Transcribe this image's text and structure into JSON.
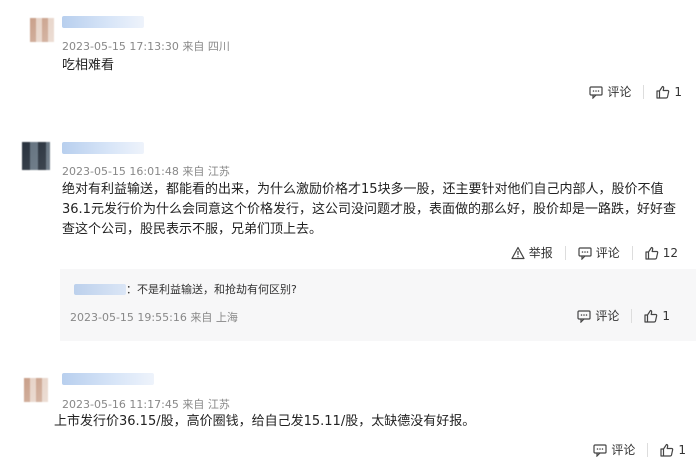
{
  "colors": {
    "background": "#ffffff",
    "meta_text": "#888888",
    "body_text": "#222222",
    "reply_background": "#f7f7f8",
    "username_blur": "#c9daf2"
  },
  "icons": {
    "comment": "speech-bubble-icon",
    "like": "thumbs-up-icon",
    "report": "warning-triangle-icon"
  },
  "comments": [
    {
      "username": "用户",
      "meta": "2023-05-15 17:13:30 来自 四川",
      "text": "吃相难看",
      "comment_label": "评论",
      "like_count": "1"
    },
    {
      "username": "用户",
      "meta": "2023-05-15 16:01:48 来自 江苏",
      "text": "绝对有利益输送，都能看的出来，为什么激励价格才15块多一股，还主要针对他们自己内部人，股价不值36.1元发行价为什么会同意这个价格发行，这公司没问题才股，表面做的那么好，股价却是一路跌，好好查查这个公司，股民表示不服，兄弟们顶上去。",
      "report_label": "举报",
      "comment_label": "评论",
      "like_count": "12",
      "reply": {
        "username": "用户",
        "text": "：不是利益输送，和抢劫有何区别?",
        "meta": "2023-05-15 19:55:16  来自 上海",
        "comment_label": "评论",
        "like_count": "1"
      }
    },
    {
      "username": "用户",
      "meta": "2023-05-16 11:17:45 来自 江苏",
      "text": "上市发行价36.15/股，高价圈钱，给自己发15.11/股，太缺德没有好报。",
      "comment_label": "评论",
      "like_count": "1"
    }
  ]
}
